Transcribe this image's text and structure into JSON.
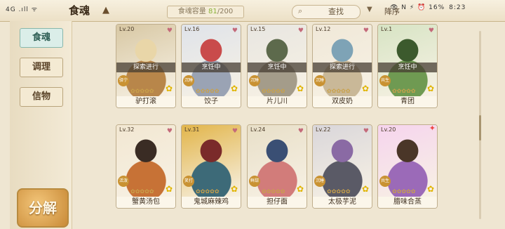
{
  "status": {
    "left": "4G .ıll ᯤ",
    "right": "👁 N ⚡ ⏰ 16%",
    "time": "8:23"
  },
  "header": {
    "title": "食魂",
    "capacity_label": "食魂容量",
    "capacity_current": "81",
    "capacity_max": "/200",
    "search_label": "查找",
    "sort_label": "降序"
  },
  "sidebar": {
    "items": [
      {
        "label": "食魂"
      },
      {
        "label": "调理"
      },
      {
        "label": "信物"
      }
    ],
    "decompose_label": "分解"
  },
  "cards": [
    {
      "level": "Lv.20",
      "name": "驴打滚",
      "status": "探索进行",
      "badge": "驿宁",
      "colors": [
        "#d8c8a4",
        "#b8864a",
        "#e9d6a8"
      ]
    },
    {
      "level": "Lv.16",
      "name": "饺子",
      "status": "烹饪中",
      "badge": "沉睡",
      "colors": [
        "#dfe3ea",
        "#9aa3b4",
        "#c94b4b"
      ]
    },
    {
      "level": "Lv.15",
      "name": "片儿川",
      "status": "烹饪中",
      "badge": "沉睡",
      "colors": [
        "#e8e6e1",
        "#a49c8a",
        "#5d6a4c"
      ]
    },
    {
      "level": "Lv.12",
      "name": "双皮奶",
      "status": "探索进行",
      "badge": "沉睡",
      "colors": [
        "#f0e8d8",
        "#c9b898",
        "#7ea3b6"
      ]
    },
    {
      "level": "Lv.1",
      "name": "青团",
      "status": "烹饪中",
      "badge": "共生",
      "colors": [
        "#d7e4c4",
        "#6f9a52",
        "#3c5a2d"
      ]
    },
    {
      "level": "Lv.32",
      "name": "蟹黄汤包",
      "status": "",
      "badge": "活泼",
      "colors": [
        "#f2e7d2",
        "#c77236",
        "#3a2c24"
      ]
    },
    {
      "level": "Lv.31",
      "name": "鬼城麻辣鸡",
      "status": "",
      "badge": "笑打",
      "colors": [
        "#e2b54a",
        "#3d6a78",
        "#7a2a2a"
      ]
    },
    {
      "level": "Lv.24",
      "name": "担仔面",
      "status": "",
      "badge": "鲜甜",
      "colors": [
        "#e8dfc8",
        "#d27c7a",
        "#3a4f74"
      ]
    },
    {
      "level": "Lv.22",
      "name": "太极芋泥",
      "status": "",
      "badge": "沉睡",
      "colors": [
        "#d9d6da",
        "#5a5a66",
        "#8a6aa4"
      ]
    },
    {
      "level": "Lv.20",
      "name": "腊味合蒸",
      "status": "",
      "badge": "共生",
      "colors": [
        "#f6d4ee",
        "#9b6ab8",
        "#4a3628"
      ]
    }
  ]
}
